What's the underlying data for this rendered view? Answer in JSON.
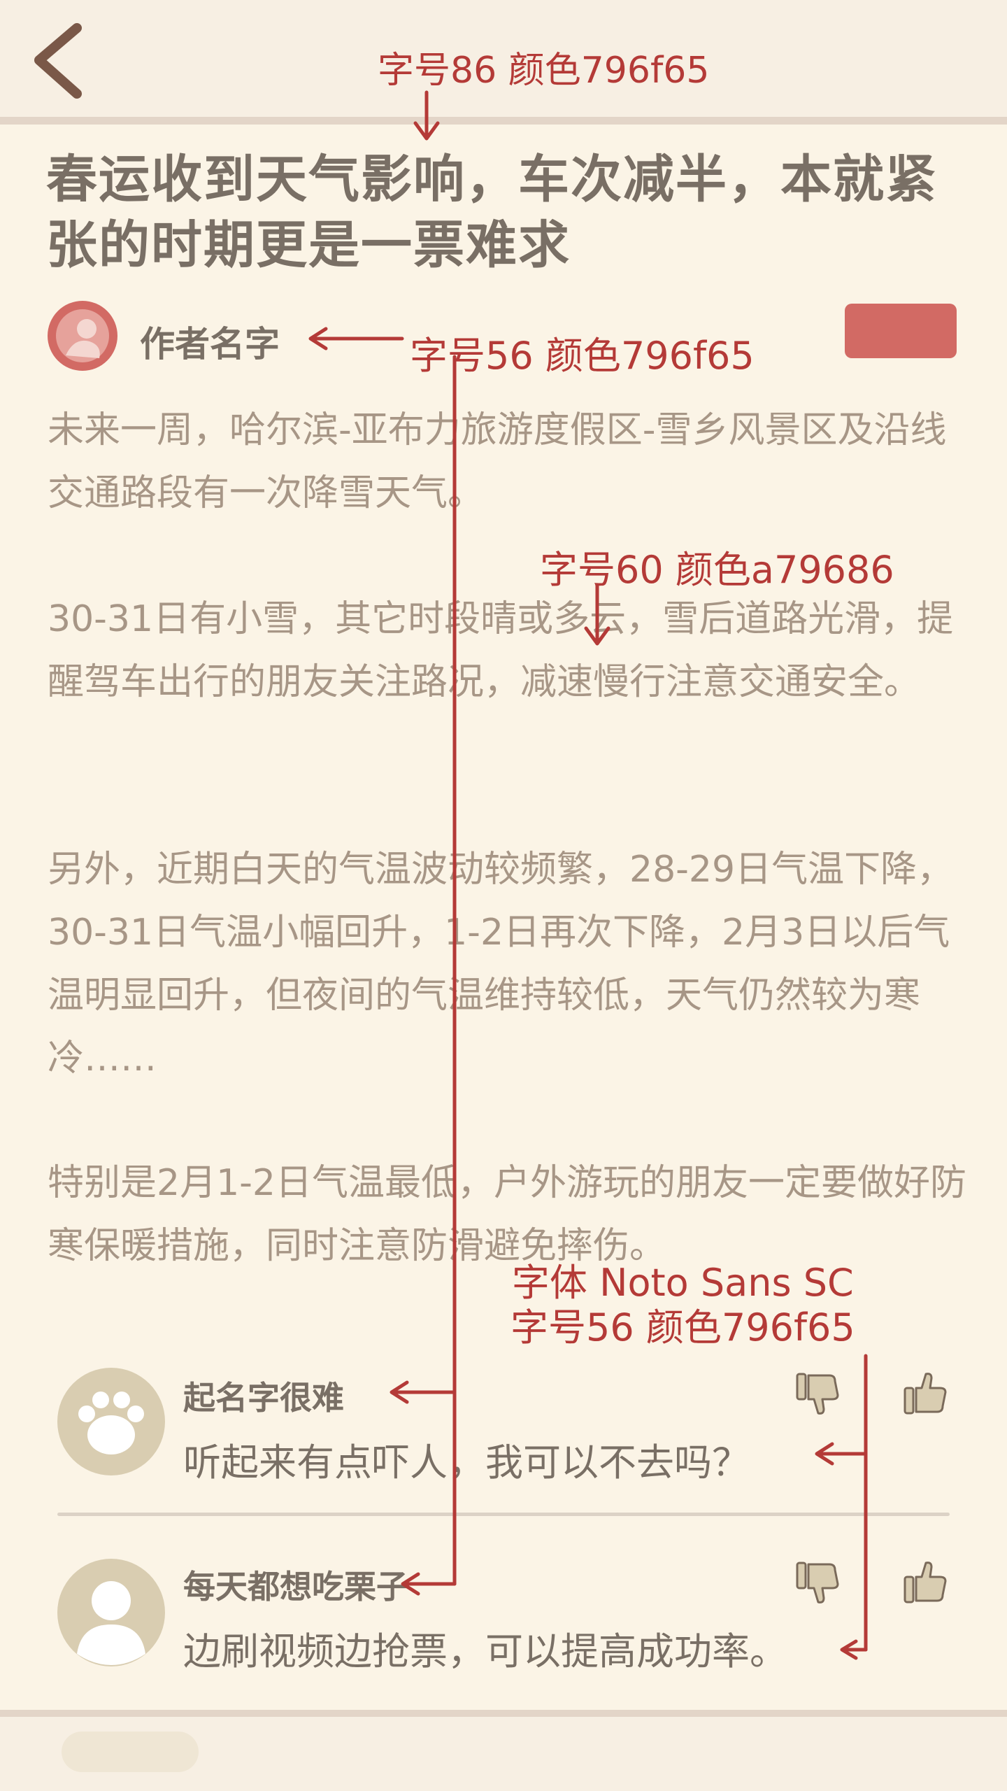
{
  "article": {
    "title": "春运收到天气影响，车次减半，本就紧张的时期更是一票难求",
    "author": "作者名字",
    "paragraphs": [
      "未来一周，哈尔滨-亚布力旅游度假区-雪乡风景区及沿线交通路段有一次降雪天气。",
      "30-31日有小雪，其它时段晴或多云，雪后道路光滑，提醒驾车出行的朋友关注路况，减速慢行注意交通安全。",
      "另外，近期白天的气温波动较频繁，28-29日气温下降，30-31日气温小幅回升，1-2日再次下降，2月3日以后气温明显回升，但夜间的气温维持较低，天气仍然较为寒冷……",
      "特别是2月1-2日气温最低，户外游玩的朋友一定要做好防寒保暖措施，同时注意防滑避免摔伤。"
    ]
  },
  "comments": [
    {
      "name": "起名字很难",
      "text": "听起来有点吓人，我可以不去吗？"
    },
    {
      "name": "每天都想吃栗子",
      "text": "边刷视频边抢票，可以提高成功率。"
    }
  ],
  "annotations": {
    "title_spec": "字号86 颜色796f65",
    "author_spec": "字号56 颜色796f65",
    "body_spec": "字号60 颜色a79686",
    "comment_spec_font": "字体 Noto Sans SC",
    "comment_spec_size": "字号56 颜色796f65"
  },
  "icons": {
    "back": "back-chevron-icon",
    "author_avatar": "author-avatar-icon",
    "paw_avatar": "paw-avatar-icon",
    "person_avatar": "person-avatar-icon",
    "dislike": "thumbs-down-icon",
    "like": "thumbs-up-icon"
  },
  "colors": {
    "title": "#796f65",
    "body": "#a79686",
    "annotation": "#b43a37",
    "background": "#fbf4e6",
    "stamp": "#d26a64"
  }
}
